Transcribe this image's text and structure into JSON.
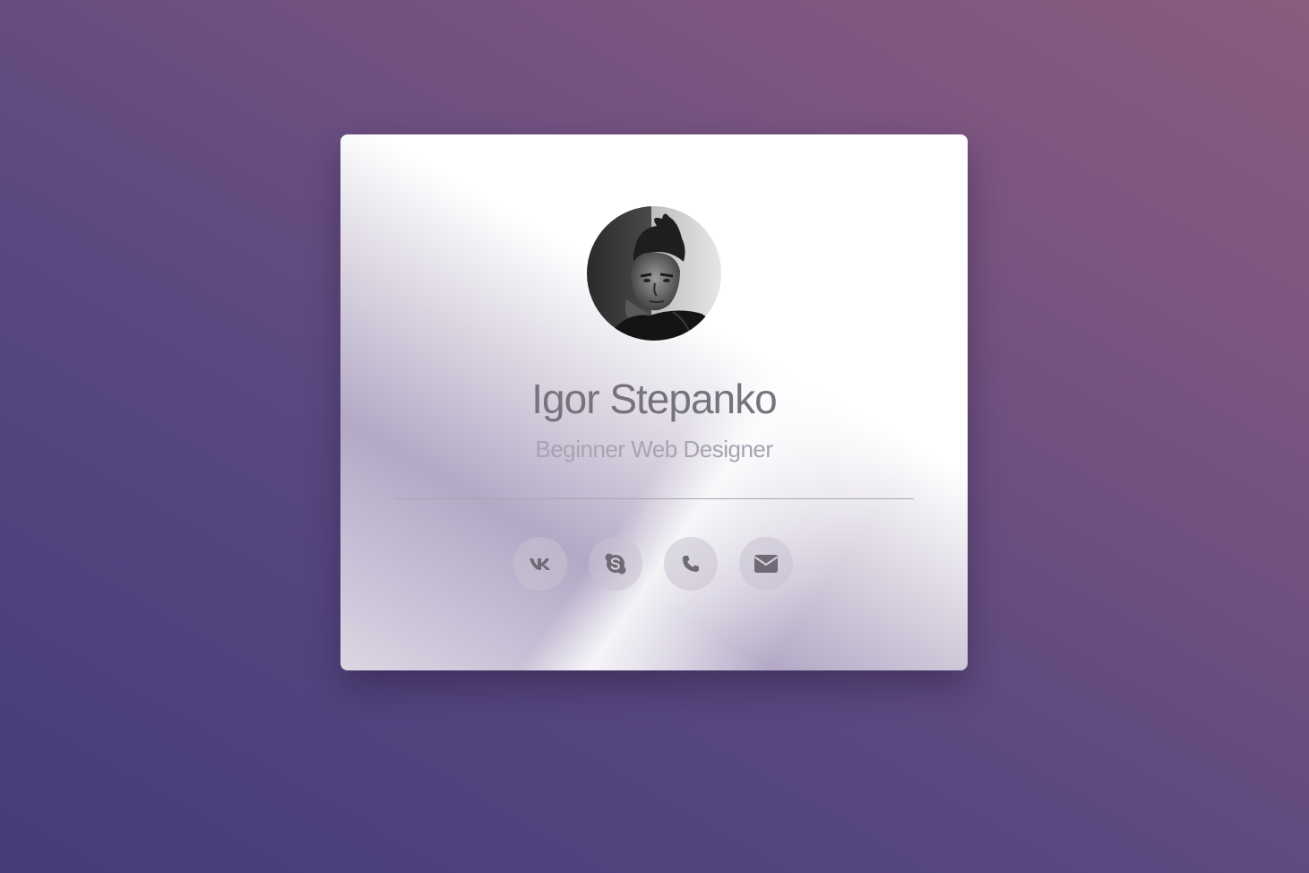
{
  "profile": {
    "name": "Igor Stepanko",
    "role": "Beginner Web Designer"
  },
  "socials": [
    {
      "icon": "vk-icon"
    },
    {
      "icon": "skype-icon"
    },
    {
      "icon": "phone-icon"
    },
    {
      "icon": "envelope-icon"
    }
  ],
  "colors": {
    "background_start": "#453c78",
    "background_end": "#8a5c7e",
    "card": "#ffffff",
    "icon": "#6e6a76"
  }
}
